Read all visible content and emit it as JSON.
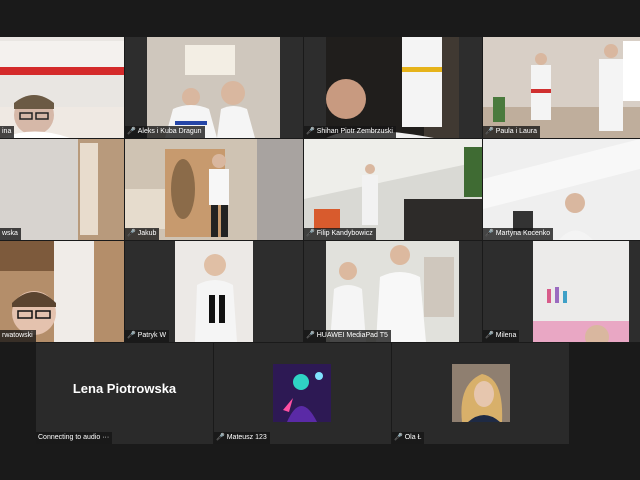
{
  "tiles": [
    {
      "label": "ina",
      "mic_muted": false,
      "active_speaker": true
    },
    {
      "label": "Aleks i Kuba Dragun",
      "mic_muted": true
    },
    {
      "label": "Shihan Piotr Zembrzuski",
      "mic_muted": true
    },
    {
      "label": "Paula i Laura",
      "mic_muted": true
    },
    {
      "label": "wska",
      "mic_muted": false
    },
    {
      "label": "Jakub",
      "mic_muted": true
    },
    {
      "label": "Filip Kandybowicz",
      "mic_muted": true
    },
    {
      "label": "Martyna Kocenko",
      "mic_muted": true
    },
    {
      "label": "rwatowski",
      "mic_muted": false
    },
    {
      "label": "Patryk W",
      "mic_muted": true
    },
    {
      "label": "HUAWEI MediaPad T5",
      "mic_muted": true
    },
    {
      "label": "Milena",
      "mic_muted": true
    },
    {
      "label": "Connecting to audio ···",
      "mic_muted": false,
      "display_name": "Lena Piotrowska"
    },
    {
      "label": "Mateusz 123",
      "mic_muted": true
    },
    {
      "label": "Ola Ł",
      "mic_muted": true
    }
  ],
  "colors": {
    "background": "#1a1a1a",
    "tile_background": "#2b2b2b",
    "active_speaker_border": "#c9e436",
    "muted_mic": "#e23b3b"
  }
}
